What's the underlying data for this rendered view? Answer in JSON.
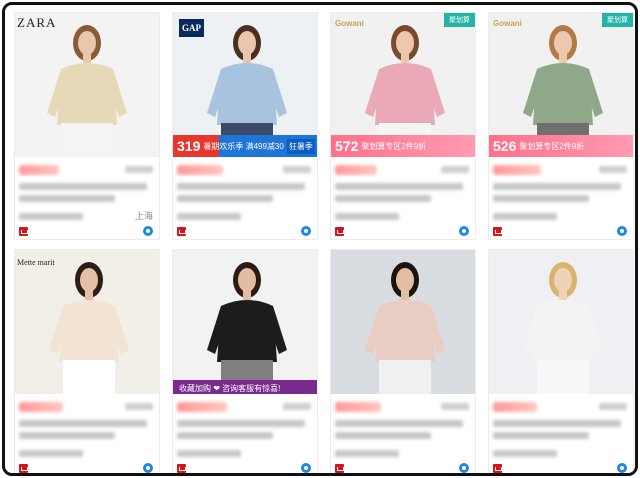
{
  "cards": [
    {
      "brand": "ZARA",
      "location": "上海",
      "colors": {
        "bg": "#f3f3f3",
        "shirt": "#e6d9b8",
        "skin": "#e8c7ad",
        "hair": "#8a5a3a",
        "pants": "#f4f4f4"
      },
      "price_width": 40
    },
    {
      "brand": "GAP",
      "promo_price": "319",
      "promo_label": "暑期欢乐季 满499减30",
      "promo_tag": "狂暑季",
      "location": "",
      "colors": {
        "bg": "#eef1f4",
        "shirt": "#a8c3dd",
        "skin": "#e9c6ac",
        "hair": "#4a3022",
        "pants": "#3b4a66"
      },
      "price_width": 46
    },
    {
      "brand": "Gowani",
      "badge": "聚划算",
      "promo_price": "572",
      "promo_label": "聚划算专区2件9折",
      "location": "",
      "colors": {
        "bg": "#f1f1f1",
        "shirt": "#e9a9b7",
        "skin": "#ecc8ae",
        "hair": "#7a4a2c",
        "pants": "#f5f5f5"
      },
      "price_width": 42
    },
    {
      "brand": "Gowani",
      "badge": "聚划算",
      "promo_price": "526",
      "promo_label": "聚划算专区2件9折",
      "location": "",
      "colors": {
        "bg": "#f1f1f1",
        "shirt": "#8fa88a",
        "skin": "#ecc8ae",
        "hair": "#b27a45",
        "pants": "#6f6f6f"
      },
      "price_width": 48
    },
    {
      "brand": "Mette marit",
      "location": "",
      "colors": {
        "bg": "#f2efe9",
        "shirt": "#f1e4d2",
        "skin": "#e6c0a6",
        "hair": "#2b1e18",
        "pants": "#ffffff"
      },
      "price_width": 44
    },
    {
      "brand": "",
      "overlay": "收藏加购 ❤ 咨询客服有惊喜!",
      "location": "",
      "colors": {
        "bg": "#f2f2f2",
        "shirt": "#1c1c1c",
        "skin": "#e3bca2",
        "hair": "#2c1b14",
        "pants": "#7f7f7f"
      },
      "price_width": 50
    },
    {
      "brand": "",
      "location": "",
      "colors": {
        "bg": "#d9dde2",
        "shirt": "#e8cdc3",
        "skin": "#e4bea3",
        "hair": "#1b1411",
        "pants": "#f0f0f0"
      },
      "price_width": 46
    },
    {
      "brand": "",
      "location": "",
      "colors": {
        "bg": "#eef0f3",
        "shirt": "#f3f3f3",
        "skin": "#efd2b8",
        "hair": "#d9b46c",
        "pants": "#f7f7f7"
      },
      "price_width": 44
    }
  ]
}
